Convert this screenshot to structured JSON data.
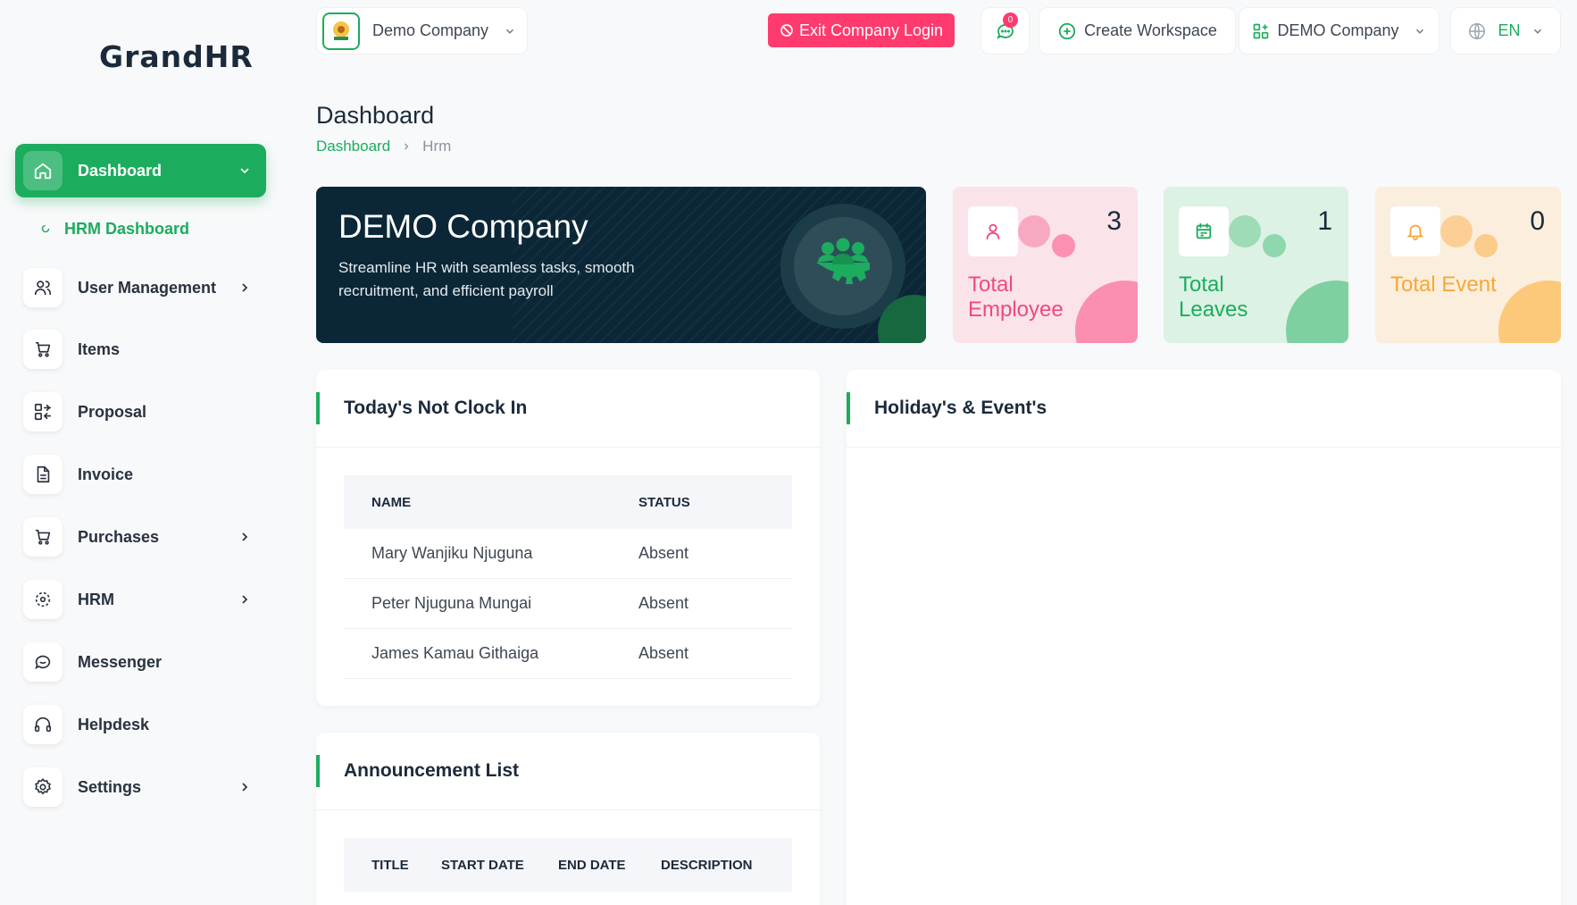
{
  "app": {
    "logo_text": "GrandHR"
  },
  "sidebar": {
    "items": [
      {
        "label": "Dashboard",
        "active": true,
        "has_chevron": true,
        "chevron": "down",
        "icon": "home-icon"
      },
      {
        "label": "User Management",
        "has_chevron": true,
        "icon": "users-icon"
      },
      {
        "label": "Items",
        "has_chevron": false,
        "icon": "cart-icon"
      },
      {
        "label": "Proposal",
        "has_chevron": false,
        "icon": "proposal-icon"
      },
      {
        "label": "Invoice",
        "has_chevron": false,
        "icon": "file-icon"
      },
      {
        "label": "Purchases",
        "has_chevron": true,
        "icon": "cart-icon"
      },
      {
        "label": "HRM",
        "has_chevron": true,
        "icon": "hrm-icon"
      },
      {
        "label": "Messenger",
        "has_chevron": false,
        "icon": "message-icon"
      },
      {
        "label": "Helpdesk",
        "has_chevron": false,
        "icon": "headphones-icon"
      },
      {
        "label": "Settings",
        "has_chevron": true,
        "icon": "gear-icon"
      }
    ],
    "sub_items": [
      {
        "label": "HRM Dashboard"
      }
    ]
  },
  "topbar": {
    "company_selector": "Demo Company",
    "exit_button": "Exit Company Login",
    "message_badge": "0",
    "create_workspace": "Create Workspace",
    "workspace_selector": "DEMO Company",
    "language": "EN"
  },
  "page": {
    "title": "Dashboard",
    "breadcrumb": [
      "Dashboard",
      "Hrm"
    ]
  },
  "hero": {
    "title": "DEMO Company",
    "subtitle": "Streamline HR with seamless tasks, smooth recruitment, and efficient payroll"
  },
  "stats": [
    {
      "label": "Total Employee",
      "value": "3",
      "icon": "user-icon",
      "color": "#ef4a7d"
    },
    {
      "label": "Total Leaves",
      "value": "1",
      "icon": "calendar-icon",
      "color": "#1cac5e"
    },
    {
      "label": "Total Event",
      "value": "0",
      "icon": "bell-icon",
      "color": "#f7a737"
    }
  ],
  "not_clock_in": {
    "title": "Today's Not Clock In",
    "columns": [
      "NAME",
      "STATUS"
    ],
    "rows": [
      {
        "name": "Mary Wanjiku Njuguna",
        "status": "Absent"
      },
      {
        "name": "Peter Njuguna Mungai",
        "status": "Absent"
      },
      {
        "name": "James Kamau Githaiga",
        "status": "Absent"
      }
    ]
  },
  "announcements": {
    "title": "Announcement List",
    "columns": [
      "TITLE",
      "START DATE",
      "END DATE",
      "DESCRIPTION"
    ]
  },
  "holidays": {
    "title": "Holiday's & Event's"
  },
  "colors": {
    "accent": "#1cac5e",
    "danger": "#ff3a6e",
    "hero_bg": "#0b2737"
  }
}
